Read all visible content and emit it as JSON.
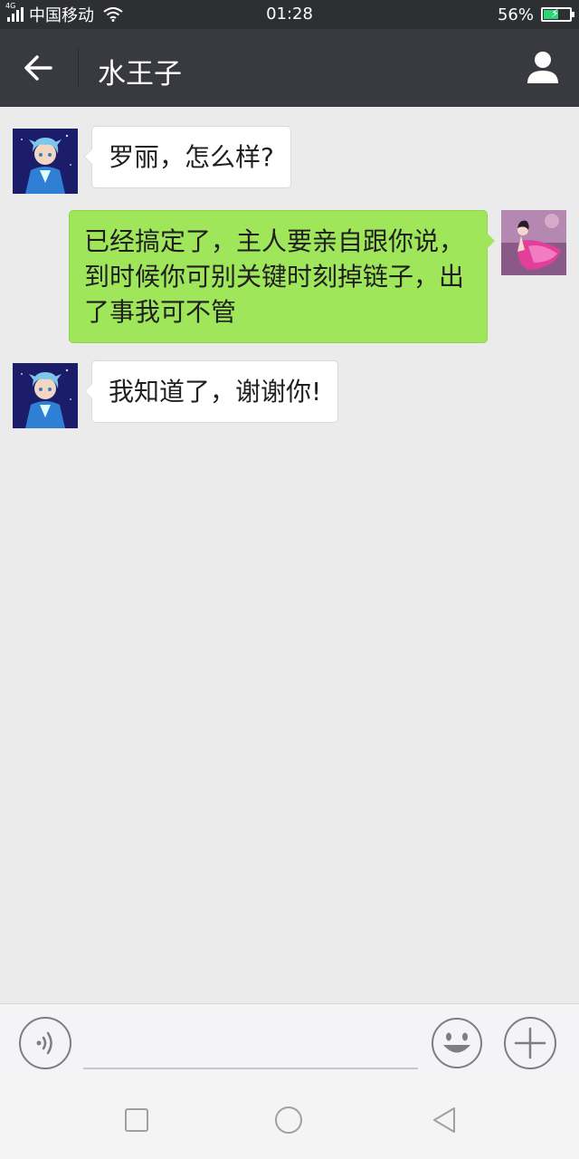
{
  "status_bar": {
    "network_tag": "4G",
    "carrier": "中国移动",
    "time": "01:28",
    "battery_percent": "56%",
    "battery_level": 0.56,
    "battery_color": "#2bd67b"
  },
  "header": {
    "title": "水王子",
    "back_icon": "arrow-left-icon",
    "profile_icon": "person-icon"
  },
  "messages": [
    {
      "sender": "contact",
      "text": "罗丽，怎么样?"
    },
    {
      "sender": "me",
      "lines": [
        "已经搞定了，主人要亲自跟你说，",
        "到时候你可别关键时刻掉链子，出",
        "了事我可不管"
      ]
    },
    {
      "sender": "contact",
      "text": "我知道了，谢谢你!"
    }
  ],
  "input_bar": {
    "voice_icon": "voice-icon",
    "text_value": "",
    "emoji_icon": "smiley-icon",
    "plus_icon": "plus-icon"
  },
  "nav_bar": {
    "icons": [
      "square-icon",
      "circle-icon",
      "triangle-back-icon"
    ]
  },
  "colors": {
    "outgoing_bubble": "#9fe65b",
    "incoming_bubble": "#ffffff",
    "header_bg": "#393a3f",
    "chat_bg": "#ebebeb"
  }
}
